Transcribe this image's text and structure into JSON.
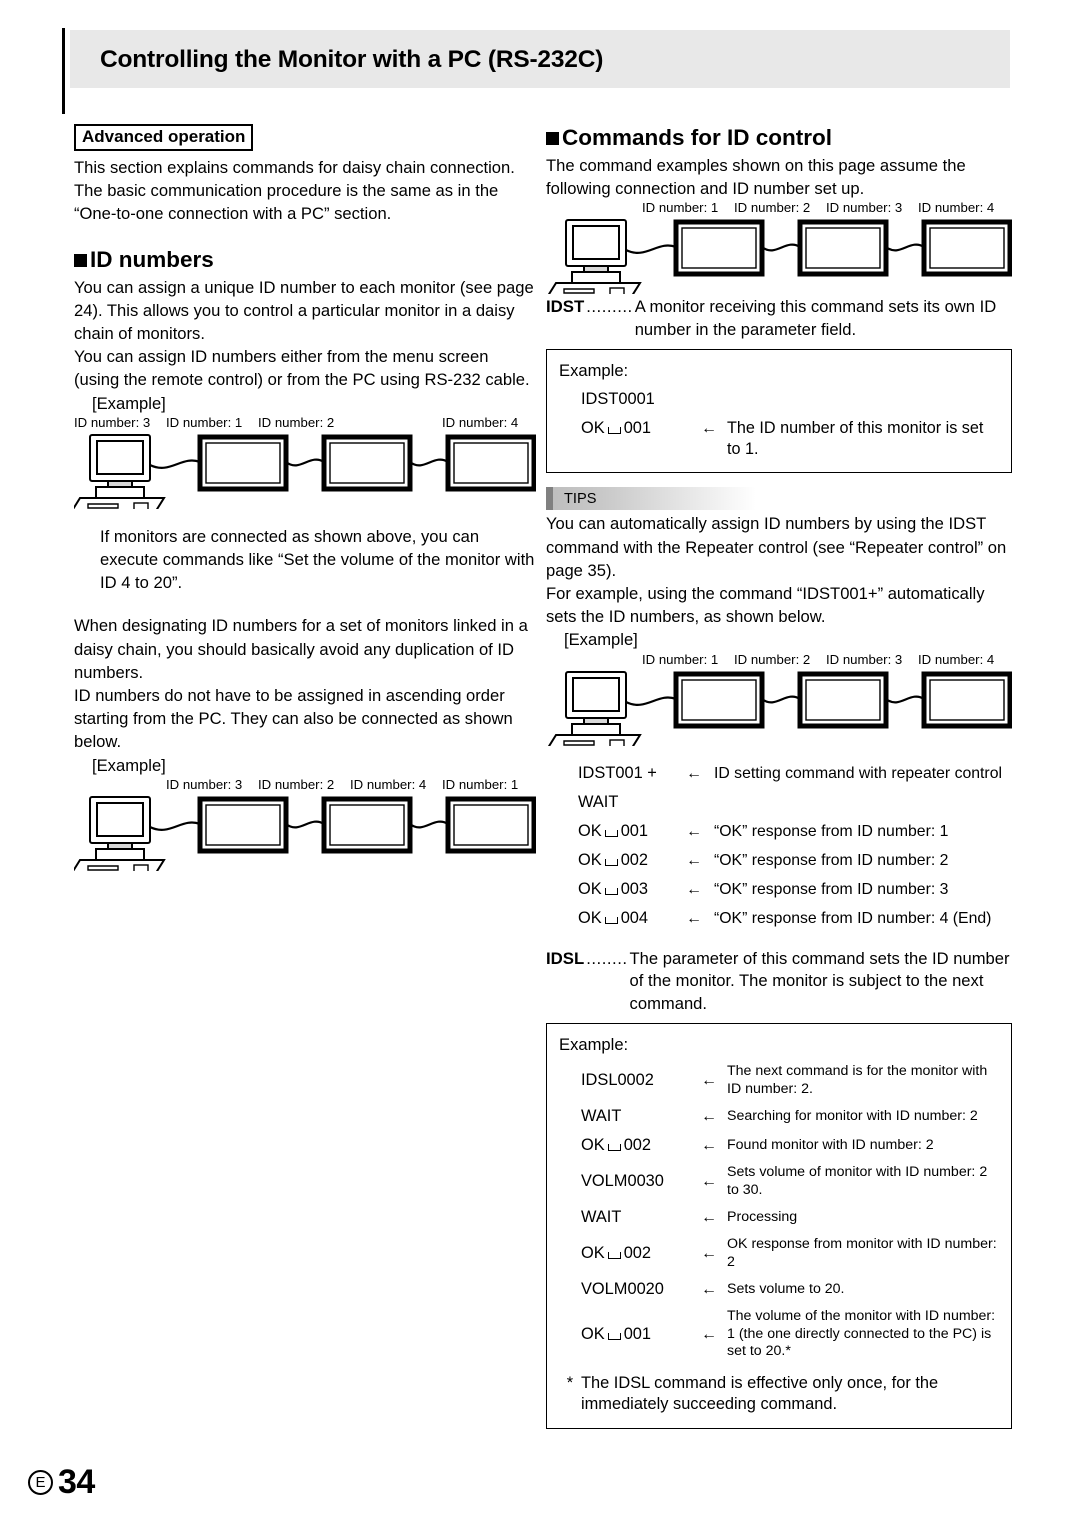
{
  "header": {
    "title": "Controlling the Monitor with a PC (RS-232C)"
  },
  "left": {
    "advanced_label": "Advanced operation",
    "advanced_paragraph": "This section explains commands for daisy chain connection. The basic communication procedure is the same as in the “One-to-one connection with a PC” section.",
    "id_numbers_heading": "ID numbers",
    "paragraph1": "You can assign a unique ID number to each monitor (see page 24). This allows you to control a particular monitor in a daisy chain of monitors.",
    "paragraph2": "You can assign ID numbers either from the menu screen (using the remote control) or from the PC using RS-232 cable.",
    "example_label_1": "[Example]",
    "diagram1_labels": [
      "ID number: 1",
      "ID number: 2",
      "ID number: 3",
      "ID number: 4"
    ],
    "paragraph3": "If monitors are connected as shown above, you can execute commands like “Set the volume of the monitor with ID 4 to 20”.",
    "paragraph4": "When designating ID numbers for a set of monitors linked in a daisy chain, you should basically avoid any duplication of ID numbers.",
    "paragraph5": "ID numbers do not have to be assigned in ascending order starting from the PC. They can also be connected as shown below.",
    "example_label_2": "[Example]",
    "diagram2_labels": [
      "ID number: 3",
      "ID number: 2",
      "ID number: 4",
      "ID number: 1"
    ]
  },
  "right": {
    "commands_heading": "Commands for ID control",
    "intro": "The command examples shown on this page assume the following connection and ID number set up.",
    "diagram_labels": [
      "ID number: 1",
      "ID number: 2",
      "ID number: 3",
      "ID number: 4"
    ],
    "idst": {
      "name": "IDST",
      "dots": ".........",
      "description": "A monitor receiving this command sets its own ID number in the parameter field.",
      "example_title": "Example:",
      "rows": [
        {
          "cmd": "IDST0001",
          "arrow": "",
          "desc": ""
        },
        {
          "cmd": "OK",
          "space": true,
          "cmd_suffix": "001",
          "arrow": "←",
          "desc": "The ID number of this monitor is set to 1."
        }
      ]
    },
    "tips": {
      "label": "TIPS",
      "paragraph1": "You can automatically assign ID numbers by using the IDST command with the Repeater control (see “Repeater control” on page 35).",
      "paragraph2": "For example, using the command “IDST001+” automatically sets the ID numbers, as shown below.",
      "example_label": "[Example]",
      "diagram_labels": [
        "ID number: 1",
        "ID number: 2",
        "ID number: 3",
        "ID number: 4"
      ],
      "rows": [
        {
          "cmd": "IDST001 +",
          "space": false,
          "arrow": "←",
          "desc": "ID setting command with repeater control"
        },
        {
          "cmd": "WAIT",
          "space": false,
          "arrow": "",
          "desc": ""
        },
        {
          "cmd": "OK",
          "space": true,
          "cmd_suffix": "001",
          "arrow": "←",
          "desc": "“OK” response from ID number: 1"
        },
        {
          "cmd": "OK",
          "space": true,
          "cmd_suffix": "002",
          "arrow": "←",
          "desc": "“OK” response from ID number: 2"
        },
        {
          "cmd": "OK",
          "space": true,
          "cmd_suffix": "003",
          "arrow": "←",
          "desc": "“OK” response from ID number: 3"
        },
        {
          "cmd": "OK",
          "space": true,
          "cmd_suffix": "004",
          "arrow": "←",
          "desc": "“OK” response from ID number: 4 (End)"
        }
      ]
    },
    "idsl": {
      "name": "IDSL",
      "dots": "........",
      "description": "The parameter of this command sets the ID number of the monitor. The monitor is subject to the next command.",
      "example_title": "Example:",
      "rows": [
        {
          "cmd": "IDSL0002",
          "space": false,
          "arrow": "←",
          "desc": "The next command is for the monitor with ID number: 2."
        },
        {
          "cmd": "WAIT",
          "space": false,
          "arrow": "←",
          "desc": "Searching for monitor with ID number: 2"
        },
        {
          "cmd": "OK",
          "space": true,
          "cmd_suffix": "002",
          "arrow": "←",
          "desc": "Found monitor with ID number: 2"
        },
        {
          "cmd": "VOLM0030",
          "space": false,
          "arrow": "←",
          "desc": "Sets volume of monitor with ID number: 2 to 30."
        },
        {
          "cmd": "WAIT",
          "space": false,
          "arrow": "←",
          "desc": "Processing"
        },
        {
          "cmd": "OK",
          "space": true,
          "cmd_suffix": "002",
          "arrow": "←",
          "desc": "OK response from monitor with ID number: 2"
        },
        {
          "cmd": "VOLM0020",
          "space": false,
          "arrow": "←",
          "desc": "Sets volume to 20."
        },
        {
          "cmd": "OK",
          "space": true,
          "cmd_suffix": "001",
          "arrow": "←",
          "desc": "The volume of the monitor with ID number: 1 (the one directly connected to the PC) is set to 20.*"
        }
      ],
      "footnote_star": "*",
      "footnote": "The IDSL command is effective only once, for the immediately succeeding command."
    }
  },
  "footer": {
    "edition": "E",
    "page_number": "34"
  }
}
